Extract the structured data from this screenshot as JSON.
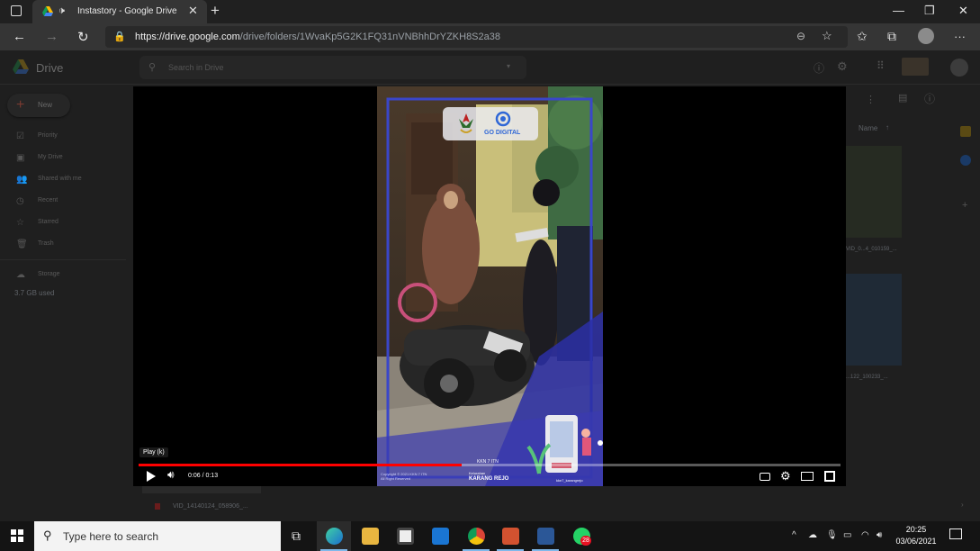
{
  "browser": {
    "tab_title": "Instastory - Google Drive",
    "tab_close": "✕",
    "new_tab": "+",
    "window_controls": {
      "minimize": "—",
      "maximize": "❐",
      "close": "✕"
    },
    "url_host": "https://drive.google.com",
    "url_path": "/drive/folders/1WvaKp5G2K1FQ31nVNBhhDrYZKH8S2a38",
    "menu": "···"
  },
  "drive": {
    "app_name": "Drive",
    "search_placeholder": "Search in Drive",
    "new_label": "New",
    "sidebar": [
      {
        "label": "Priority",
        "icon": "☑"
      },
      {
        "label": "My Drive",
        "icon": "▣"
      },
      {
        "label": "Shared with me",
        "icon": "👥"
      },
      {
        "label": "Recent",
        "icon": "◷"
      },
      {
        "label": "Starred",
        "icon": "☆"
      },
      {
        "label": "Trash",
        "icon": "🗑"
      }
    ],
    "storage_label": "Storage",
    "storage_used": "3.7 GB used",
    "sort_label": "Name",
    "file_name_1": "VID_0...4_010159_...",
    "file_name_2": "...122_100233_...",
    "file_name_bottom": "VID_14140124_058906_..."
  },
  "player": {
    "tooltip": "Play (k)",
    "time": "0:06 / 0:13",
    "progress_fraction": 0.46,
    "badge": "GO DIGITAL",
    "copyright": "Copyright © 2021 KKN 7 ITN\nAll Right Reserved",
    "kelurahan_label": "Kelurahan",
    "kelurahan_name": "KARANG REJO",
    "handle": "kkn7_karangrejo",
    "kkn_tag": "KKN 7 ITN"
  },
  "taskbar": {
    "search_placeholder": "Type here to search",
    "time": "20:25",
    "date": "03/06/2021",
    "whatsapp_badge": "28"
  }
}
